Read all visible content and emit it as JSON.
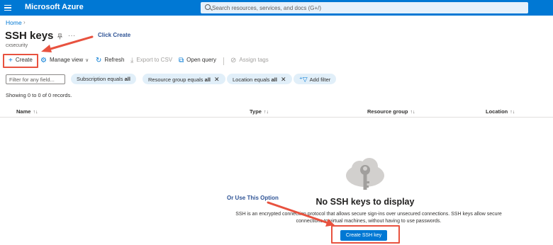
{
  "header": {
    "brand": "Microsoft Azure",
    "search_placeholder": "Search resources, services, and docs (G+/)"
  },
  "breadcrumb": {
    "home": "Home",
    "separator": "›"
  },
  "page": {
    "title": "SSH keys",
    "subtitle": "cxsecurity",
    "more_label": "···"
  },
  "toolbar": {
    "create": "Create",
    "manage_view": "Manage view",
    "refresh": "Refresh",
    "export": "Export to CSV",
    "open_query": "Open query",
    "assign_tags": "Assign tags"
  },
  "filters": {
    "placeholder": "Filter for any field...",
    "pills": [
      {
        "label": "Subscription equals",
        "value": "all"
      },
      {
        "label": "Resource group equals",
        "value": "all"
      },
      {
        "label": "Location equals",
        "value": "all"
      }
    ],
    "add_filter": "Add filter"
  },
  "records_text": "Showing 0 to 0 of 0 records.",
  "table": {
    "columns": [
      "Name",
      "Type",
      "Resource group",
      "Location"
    ],
    "sort_glyph_name": "↑↓",
    "sort_glyph": "↑↓"
  },
  "empty_state": {
    "title": "No SSH keys to display",
    "description": "SSH is an encrypted connection protocol that allows secure sign-ins over unsecured connections. SSH keys allow secure connections to virtual machines, without having to use passwords.",
    "button": "Create SSH key"
  },
  "annotations": {
    "click_create": "Click Create",
    "or_use": "Or Use This Option"
  },
  "icons": {
    "menu": "hamburger-icon",
    "search": "search-icon",
    "pin": "pin-icon",
    "create": "plus-icon",
    "manage_view": "gear-icon",
    "refresh": "refresh-icon",
    "export": "download-icon",
    "open_query": "query-icon",
    "assign_tags": "tag-icon",
    "remove": "close-icon",
    "add_filter": "add-filter-icon",
    "empty": "cloud-key-icon"
  },
  "colors": {
    "brand_blue": "#0078d4",
    "highlight_red": "#e8523f",
    "annotation_blue": "#2f5496",
    "pill_bg": "#e1eff9"
  }
}
